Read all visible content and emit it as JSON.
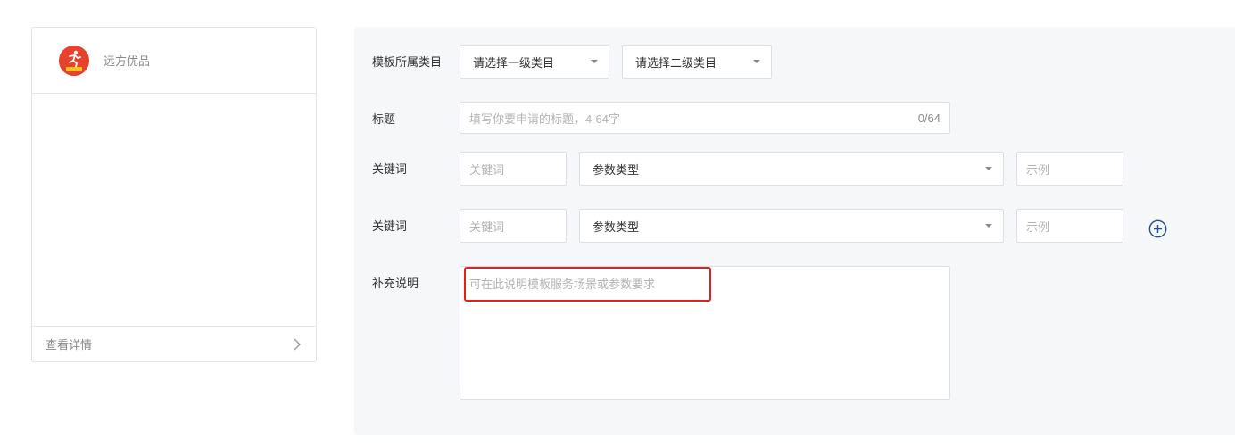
{
  "preview": {
    "app_name": "远方优品",
    "logo_text": "远方优品",
    "view_detail": "查看详情"
  },
  "form": {
    "category": {
      "label": "模板所属类目",
      "level1_placeholder": "请选择一级类目",
      "level2_placeholder": "请选择二级类目"
    },
    "title": {
      "label": "标题",
      "placeholder": "填写你要申请的标题，4-64字",
      "counter": "0/64"
    },
    "keywords": [
      {
        "label": "关键词",
        "keyword_placeholder": "关键词",
        "param_type": "参数类型",
        "example_placeholder": "示例"
      },
      {
        "label": "关键词",
        "keyword_placeholder": "关键词",
        "param_type": "参数类型",
        "example_placeholder": "示例"
      }
    ],
    "supplement": {
      "label": "补充说明",
      "placeholder": "可在此说明模板服务场景或参数要求"
    }
  },
  "colors": {
    "highlight": "#e02020",
    "avatar_bg": "#e8412c",
    "panel_bg": "#f6f7f9",
    "add_icon": "#1f4e8c"
  },
  "icons": {
    "add": "plus-circle-icon",
    "select_caret": "caret-down-icon",
    "footer_chevron": "chevron-right-icon"
  }
}
